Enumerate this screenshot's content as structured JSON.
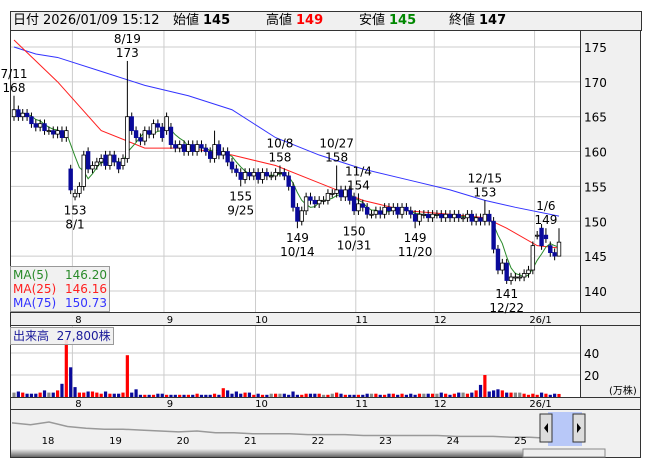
{
  "header": {
    "date_label": "日付",
    "datetime": "2026/01/09 15:12",
    "open_label": "始値",
    "open": "145",
    "high_label": "高値",
    "high": "149",
    "low_label": "安値",
    "low": "145",
    "close_label": "終値",
    "close": "147"
  },
  "legend": {
    "ma5_label": "MA(5)",
    "ma5": "146.20",
    "ma25_label": "MA(25)",
    "ma25": "146.16",
    "ma75_label": "MA(75)",
    "ma75": "150.73"
  },
  "volume_legend": {
    "label": "出来高",
    "value": "27,800株"
  },
  "chart_data": {
    "type": "candlestick",
    "price_axis": {
      "min": 137,
      "max": 177,
      "ticks": [
        140,
        145,
        150,
        155,
        160,
        165,
        170,
        175
      ]
    },
    "volume_axis": {
      "ticks": [
        20,
        40
      ],
      "unit": "(万株)"
    },
    "months": [
      {
        "label": "8",
        "idx": 15
      },
      {
        "label": "9",
        "idx": 36
      },
      {
        "label": "10",
        "idx": 57
      },
      {
        "label": "11",
        "idx": 80
      },
      {
        "label": "12",
        "idx": 98
      },
      {
        "label": "26/1",
        "idx": 121
      }
    ],
    "open": [
      165,
      166,
      165,
      165.5,
      165,
      164,
      163.5,
      164,
      163,
      163,
      162.5,
      163,
      162,
      157.5,
      153.5,
      154,
      155,
      160,
      157.5,
      158,
      158.5,
      159.5,
      158,
      159.5,
      158.5,
      158,
      159,
      165,
      163,
      162,
      161.5,
      163,
      162.5,
      164,
      163.5,
      163,
      163.5,
      161,
      160.5,
      161,
      160,
      161,
      160,
      161,
      160.5,
      160,
      159,
      161,
      159.5,
      160,
      158.5,
      157.5,
      157,
      156,
      157,
      156.5,
      157,
      156,
      157,
      156.5,
      156.5,
      157,
      157,
      156.5,
      155,
      152,
      150,
      151.5,
      153.5,
      153,
      152.5,
      153,
      153,
      154,
      154,
      154.5,
      153.5,
      154.5,
      153.5,
      151.5,
      152.5,
      152,
      151,
      151,
      151.5,
      151,
      152,
      151.5,
      152,
      151,
      152,
      151.5,
      151,
      150,
      151,
      151,
      150.5,
      151,
      151,
      150.5,
      151,
      150.5,
      151,
      150.5,
      150.5,
      151,
      150,
      150.5,
      150,
      151,
      150,
      146,
      143,
      144,
      141.5,
      142,
      142,
      142,
      142.5,
      143,
      148,
      149,
      148,
      146.5,
      145.5,
      145
    ],
    "close": [
      166,
      165,
      165.5,
      165,
      164,
      163.5,
      164,
      163,
      163,
      162.5,
      163,
      162,
      163,
      154.5,
      154,
      155,
      159.5,
      157.5,
      158,
      158.5,
      159,
      158,
      159.5,
      158.5,
      157.5,
      159,
      165,
      163,
      162,
      161.5,
      163,
      162.5,
      164,
      163.5,
      162,
      165,
      161,
      160.5,
      161,
      160,
      161,
      160,
      161,
      160.5,
      160,
      159,
      161,
      159.5,
      160,
      158.5,
      157.5,
      157,
      156,
      157,
      156.5,
      157,
      156,
      157,
      156.5,
      156.5,
      157,
      157,
      156.5,
      155,
      152,
      150,
      151.5,
      153.5,
      153,
      152.5,
      153,
      153,
      154,
      154,
      154.5,
      153.5,
      154.5,
      153,
      151.5,
      152.5,
      152,
      151,
      151,
      151.5,
      151,
      152,
      151.5,
      152,
      151,
      152,
      151.5,
      151,
      150,
      151,
      151,
      150.5,
      151,
      151,
      150.5,
      151,
      150.5,
      151,
      150.5,
      150.5,
      151,
      150,
      150.5,
      150,
      151,
      150,
      146,
      143,
      144,
      141.5,
      142,
      142,
      142,
      142.5,
      143,
      146.5,
      148,
      146.5,
      147.5,
      145.5,
      145,
      147
    ],
    "high_overrides": {
      "0": 168,
      "26": 173,
      "46": 163,
      "61": 158,
      "74": 158,
      "79": 154,
      "108": 153,
      "122": 149,
      "125": 149
    },
    "low_overrides": {
      "14": 153,
      "52": 155,
      "65": 149,
      "92": 149,
      "113": 141,
      "125": 145
    },
    "wick": 0.6,
    "volume": [
      4,
      5,
      4,
      3,
      3,
      3,
      4,
      6,
      4,
      4,
      6,
      12,
      52,
      27,
      9,
      4,
      4,
      5,
      5,
      4,
      3,
      5,
      3,
      3,
      3,
      4,
      38,
      4,
      7,
      2,
      2,
      2,
      2,
      3,
      3,
      2,
      2,
      2,
      2,
      2,
      2,
      2,
      3,
      2,
      2,
      2,
      3,
      2,
      8,
      6,
      3,
      5,
      3,
      4,
      4,
      2,
      3,
      2,
      2,
      3,
      3,
      3,
      3,
      2,
      5,
      2,
      2,
      3,
      3,
      3,
      3,
      2,
      2,
      3,
      4,
      3,
      2,
      2,
      2,
      2,
      2,
      3,
      3,
      3,
      2,
      2,
      3,
      3,
      2,
      3,
      2,
      3,
      2,
      3,
      3,
      3,
      3,
      3,
      4,
      3,
      2,
      3,
      4,
      4,
      3,
      4,
      6,
      11,
      20,
      5,
      6,
      7,
      6,
      4,
      4,
      4,
      4,
      3,
      2,
      3,
      2,
      4,
      3,
      2,
      3,
      2.78
    ],
    "ma25_points": [
      [
        0,
        176
      ],
      [
        10,
        170
      ],
      [
        20,
        163
      ],
      [
        30,
        160.5
      ],
      [
        40,
        160.5
      ],
      [
        50,
        159.5
      ],
      [
        60,
        158
      ],
      [
        70,
        155.5
      ],
      [
        80,
        153
      ],
      [
        90,
        151.5
      ],
      [
        100,
        151
      ],
      [
        108,
        150.5
      ],
      [
        113,
        149
      ],
      [
        120,
        146.5
      ],
      [
        125,
        146.16
      ]
    ],
    "ma75_points": [
      [
        0,
        175
      ],
      [
        5,
        174
      ],
      [
        10,
        173.5
      ],
      [
        20,
        171.5
      ],
      [
        30,
        169.5
      ],
      [
        40,
        168
      ],
      [
        50,
        166
      ],
      [
        60,
        162
      ],
      [
        70,
        159.5
      ],
      [
        80,
        157.5
      ],
      [
        90,
        156
      ],
      [
        100,
        154.5
      ],
      [
        108,
        153
      ],
      [
        115,
        152
      ],
      [
        125,
        150.73
      ]
    ],
    "annotations": [
      {
        "date": "7/11",
        "value": "168",
        "idx": 0,
        "price": 168,
        "pos": "above"
      },
      {
        "date": "8/19",
        "value": "173",
        "idx": 26,
        "price": 173,
        "pos": "above"
      },
      {
        "date": "8/1",
        "value": "153",
        "idx": 14,
        "price": 153,
        "pos": "below"
      },
      {
        "date": "9/25",
        "value": "155",
        "idx": 52,
        "price": 155,
        "pos": "below"
      },
      {
        "date": "10/8",
        "value": "158",
        "idx": 61,
        "price": 158,
        "pos": "above"
      },
      {
        "date": "10/14",
        "value": "149",
        "idx": 65,
        "price": 149,
        "pos": "below"
      },
      {
        "date": "10/27",
        "value": "158",
        "idx": 74,
        "price": 158,
        "pos": "above"
      },
      {
        "date": "10/31",
        "value": "150",
        "idx": 78,
        "price": 150,
        "pos": "below"
      },
      {
        "date": "11/4",
        "value": "154",
        "idx": 79,
        "price": 154,
        "pos": "above"
      },
      {
        "date": "11/20",
        "value": "149",
        "idx": 92,
        "price": 149,
        "pos": "below"
      },
      {
        "date": "12/15",
        "value": "153",
        "idx": 108,
        "price": 153,
        "pos": "above"
      },
      {
        "date": "12/22",
        "value": "141",
        "idx": 113,
        "price": 141,
        "pos": "below"
      },
      {
        "date": "1/6",
        "value": "149",
        "idx": 122,
        "price": 149,
        "pos": "above"
      }
    ],
    "navigator": {
      "years": [
        "18",
        "19",
        "20",
        "21",
        "22",
        "23",
        "24",
        "25"
      ],
      "values": [
        190,
        188,
        191,
        186,
        184,
        183,
        183,
        182,
        181,
        180,
        181,
        179,
        179,
        178,
        178,
        178,
        177,
        177,
        177,
        176,
        176,
        176,
        176,
        176,
        175,
        175,
        175,
        174,
        174,
        173
      ]
    },
    "colors": {
      "up": "#ffffff",
      "down": "#0a0a9a",
      "ma5": "#2a8a2a",
      "ma25": "#ff2020",
      "ma75": "#3333ff",
      "vol_up": "#ff0000",
      "vol_down": "#0a0a9a",
      "vol_flat": "#888888"
    }
  }
}
